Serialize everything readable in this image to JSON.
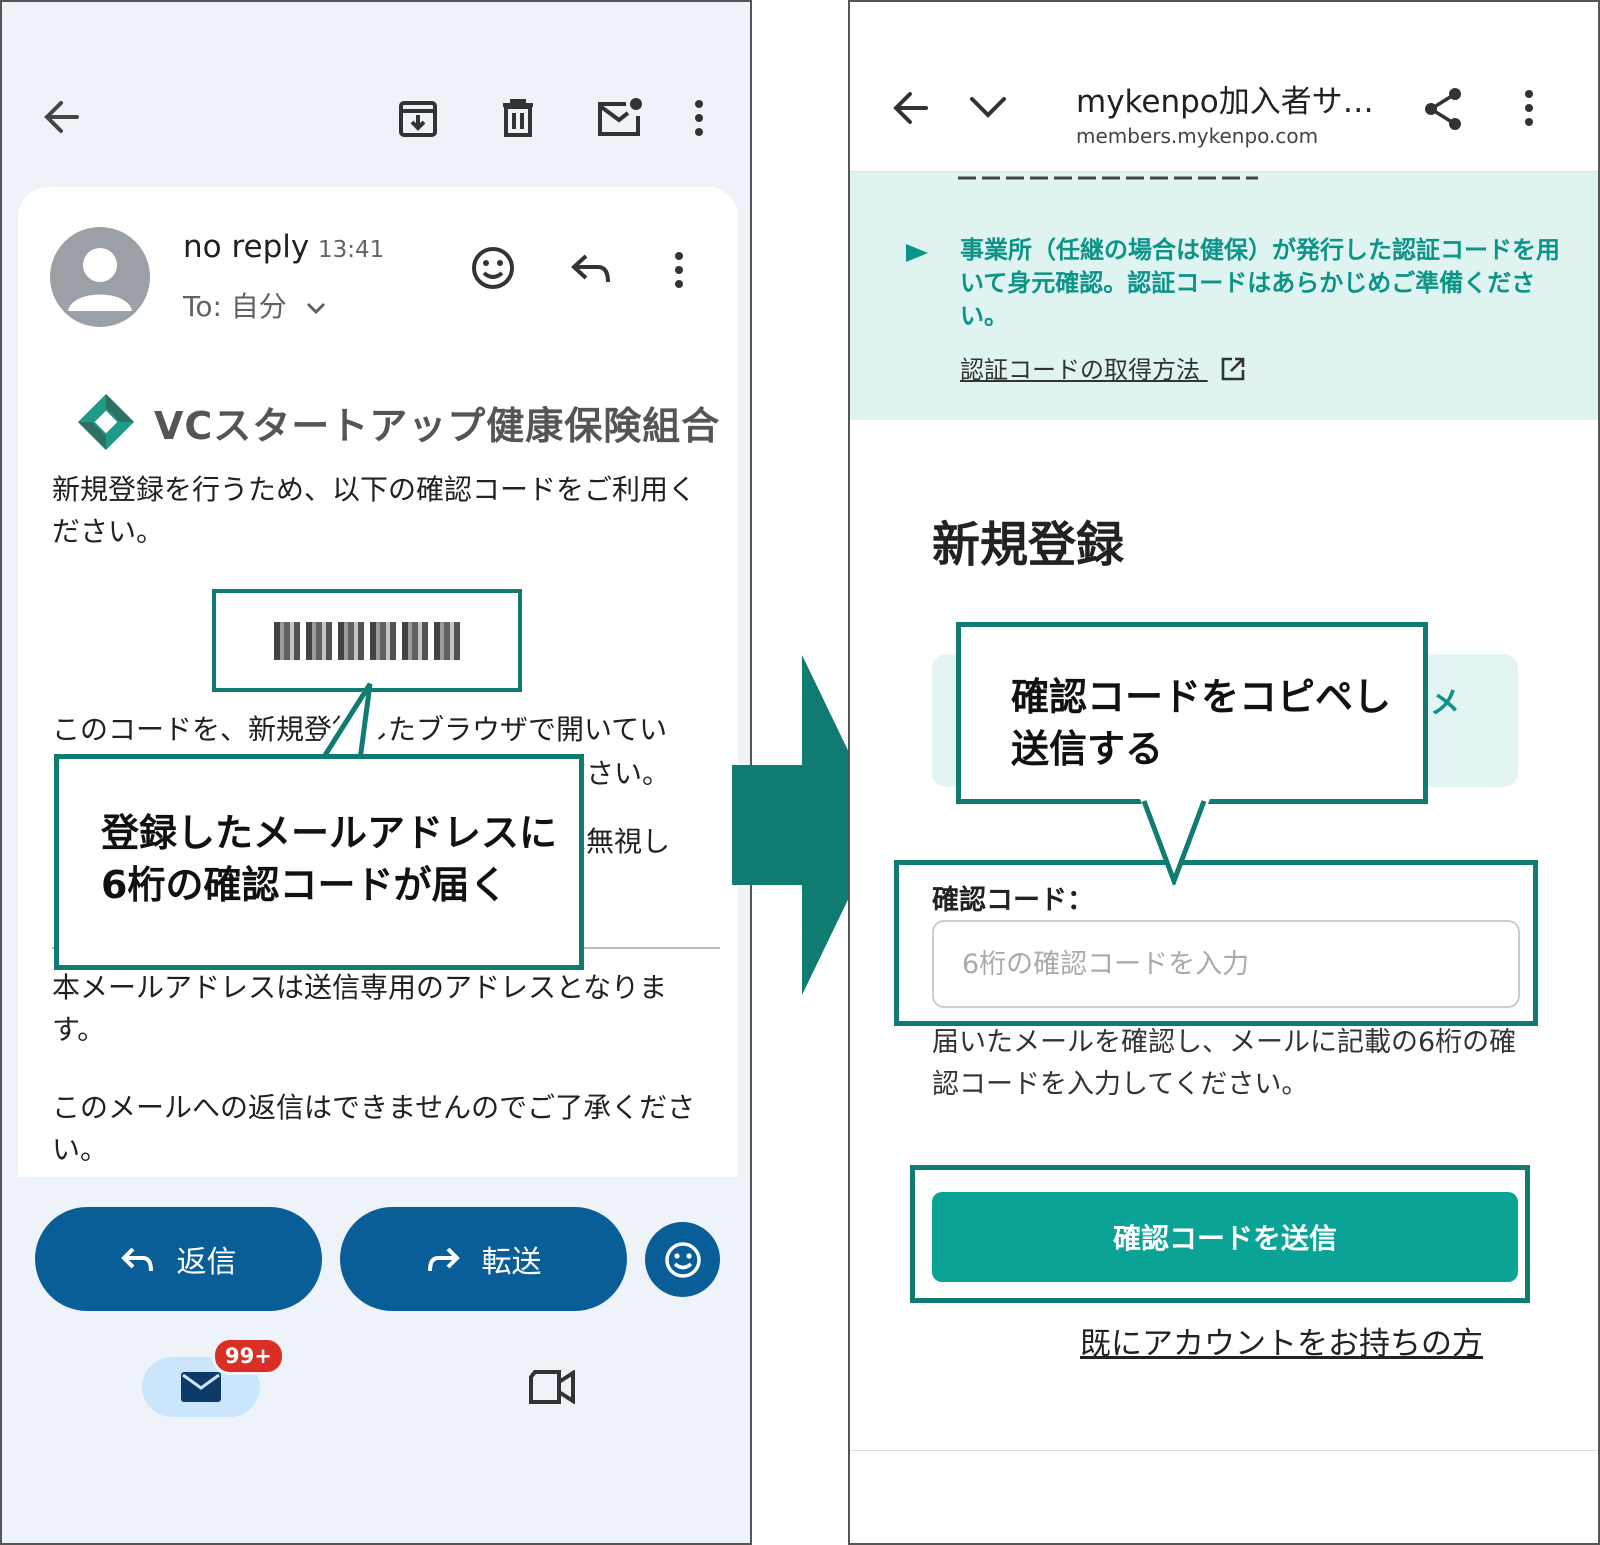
{
  "email": {
    "sender": "no reply",
    "time": "13:41",
    "to": "To: 自分",
    "org_name": "VCスタートアップ健康保険組合",
    "intro": "新規登録を行うため、以下の確認コードをご利用ください。",
    "partial_line_1": "このコードを、新規登録したブラウザで開いてい",
    "partial_line_2": "ださい。",
    "partial_line_3": "は無視し",
    "notice_1": "本メールアドレスは送信専用のアドレスとなります。",
    "notice_2": "このメールへの返信はできませんのでご了承ください。",
    "reply_label": "返信",
    "forward_label": "転送",
    "badge": "99+"
  },
  "callouts": {
    "left_line1": "登録したメールアドレスに",
    "left_line2": "6桁の確認コードが届く",
    "right_line1": "確認コードをコピペし",
    "right_line2": "送信する"
  },
  "browser": {
    "title": "mykenpo加入者サ…",
    "url": "members.mykenpo.com",
    "info_text": "事業所（任継の場合は健保）が発行した認証コードを用いて身元確認。認証コードはあらかじめご準備ください。",
    "info_link": "認証コードの取得方法",
    "chip_mark": "メ",
    "page_title": "新規登録",
    "field_label": "確認コード：",
    "field_placeholder": "6桁の確認コードを入力",
    "help_text": "届いたメールを確認し、メールに記載の6桁の確認コードを入力してください。",
    "submit_label": "確認コードを送信",
    "account_link": "既にアカウントをお持ちの方"
  },
  "colors": {
    "accent_teal": "#0f7b71",
    "button_teal": "#0aa395",
    "gmail_blue": "#0a5e98",
    "badge_red": "#d93025"
  }
}
